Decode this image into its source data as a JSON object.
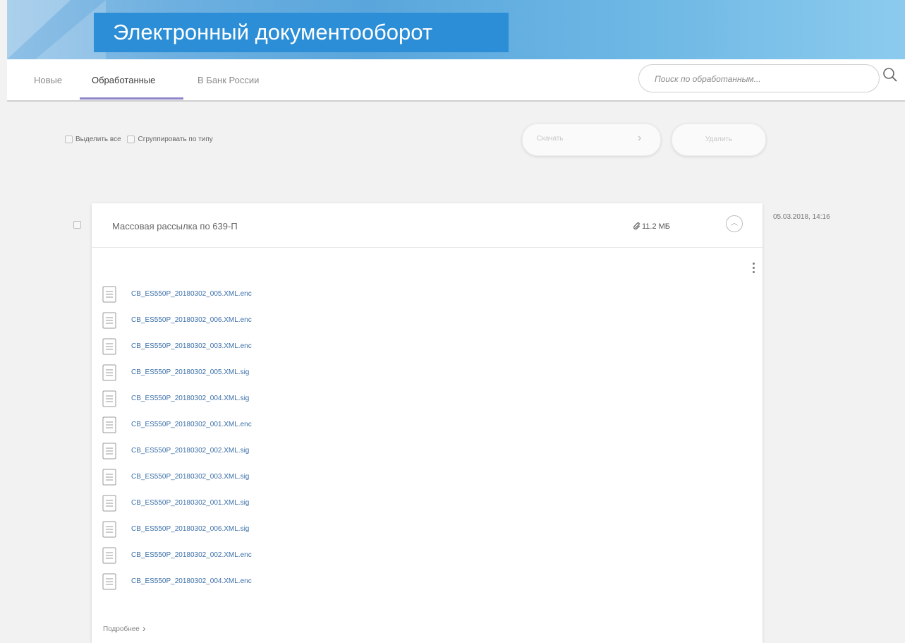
{
  "app": {
    "title": "Электронный документооборот"
  },
  "tabs": [
    {
      "label": "Новые",
      "active": false
    },
    {
      "label": "Обработанные",
      "active": true
    },
    {
      "label": "В Банк России",
      "active": false
    }
  ],
  "search": {
    "placeholder": "Поиск по обработанным..."
  },
  "toolbar": {
    "select_all_label": "Выделить все",
    "group_by_type_label": "Сгруппировать по типу",
    "download_label": "Скачать",
    "delete_label": "Удалить"
  },
  "message": {
    "title": "Массовая рассылка по 639-П",
    "size": "11.2 МБ",
    "date": "05.03.2018, 14:16",
    "files": [
      "CB_ES550P_20180302_005.XML.enc",
      "CB_ES550P_20180302_006.XML.enc",
      "CB_ES550P_20180302_003.XML.enc",
      "CB_ES550P_20180302_005.XML.sig",
      "CB_ES550P_20180302_004.XML.sig",
      "CB_ES550P_20180302_001.XML.enc",
      "CB_ES550P_20180302_002.XML.sig",
      "CB_ES550P_20180302_003.XML.sig",
      "CB_ES550P_20180302_001.XML.sig",
      "CB_ES550P_20180302_006.XML.sig",
      "CB_ES550P_20180302_002.XML.enc",
      "CB_ES550P_20180302_004.XML.enc"
    ],
    "more_label": "Подробнее"
  },
  "icons": {
    "search": "search-icon",
    "attachment": "paperclip-icon",
    "collapse": "chevron-up-icon",
    "menu": "kebab-menu-icon",
    "file": "document-icon",
    "chevron": "chevron-right-icon"
  },
  "colors": {
    "title_box": "#2b8ed6",
    "tab_underline": "#8d86c9",
    "file_link": "#3b6fa8"
  }
}
